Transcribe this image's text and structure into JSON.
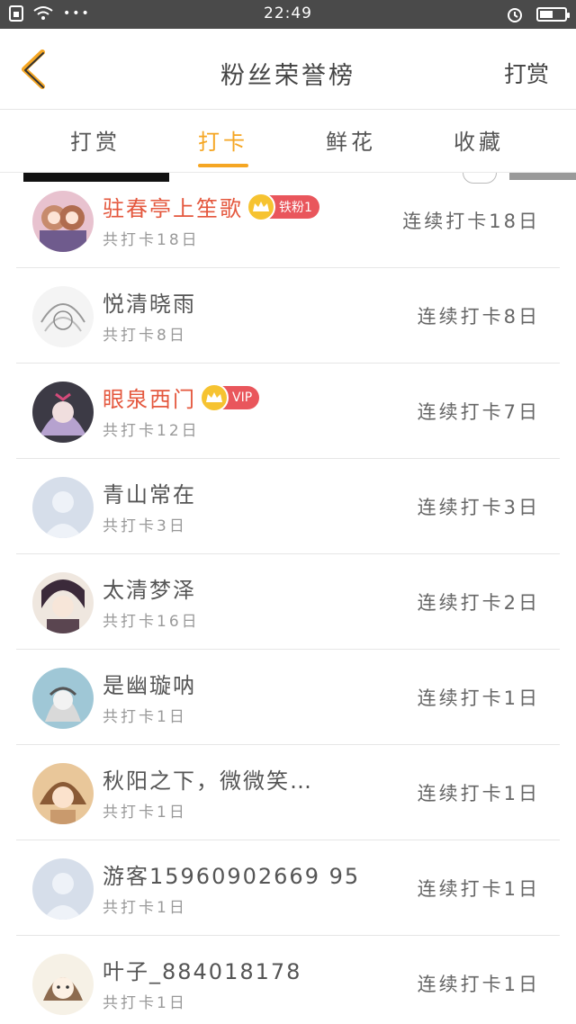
{
  "status_bar": {
    "time": "22:49"
  },
  "header": {
    "title": "粉丝荣誉榜",
    "action": "打赏"
  },
  "tabs": [
    {
      "label": "打赏",
      "active": false
    },
    {
      "label": "打卡",
      "active": true
    },
    {
      "label": "鲜花",
      "active": false
    },
    {
      "label": "收藏",
      "active": false
    }
  ],
  "rows": [
    {
      "name": "驻春亭上笙歌",
      "badge": "铁粉1",
      "total": "共打卡18日",
      "streak": "连续打卡18日"
    },
    {
      "name": "悦清晓雨",
      "badge": "",
      "total": "共打卡8日",
      "streak": "连续打卡8日"
    },
    {
      "name": "眼泉西门",
      "badge": "VIP",
      "total": "共打卡12日",
      "streak": "连续打卡7日"
    },
    {
      "name": "青山常在",
      "badge": "",
      "total": "共打卡3日",
      "streak": "连续打卡3日"
    },
    {
      "name": "太清梦泽",
      "badge": "",
      "total": "共打卡16日",
      "streak": "连续打卡2日"
    },
    {
      "name": "是幽璇呐",
      "badge": "",
      "total": "共打卡1日",
      "streak": "连续打卡1日"
    },
    {
      "name": "秋阳之下，微微笑…",
      "badge": "",
      "total": "共打卡1日",
      "streak": "连续打卡1日"
    },
    {
      "name": "游客15960902669 95",
      "badge": "",
      "total": "共打卡1日",
      "streak": "连续打卡1日"
    },
    {
      "name": "叶子_884018178",
      "badge": "",
      "total": "共打卡1日",
      "streak": "连续打卡1日"
    }
  ],
  "colors": {
    "accent": "#f5a623",
    "vip_name": "#e4573d",
    "badge_bg": "#e9565c",
    "crown": "#f6c331"
  },
  "icons": {
    "back": "chevron-left-icon",
    "crown": "crown-icon",
    "alarm": "alarm-icon",
    "battery": "battery-icon",
    "wifi": "wifi-icon",
    "sim": "sim-icon",
    "placeholder_avatar": "default-avatar-icon"
  }
}
